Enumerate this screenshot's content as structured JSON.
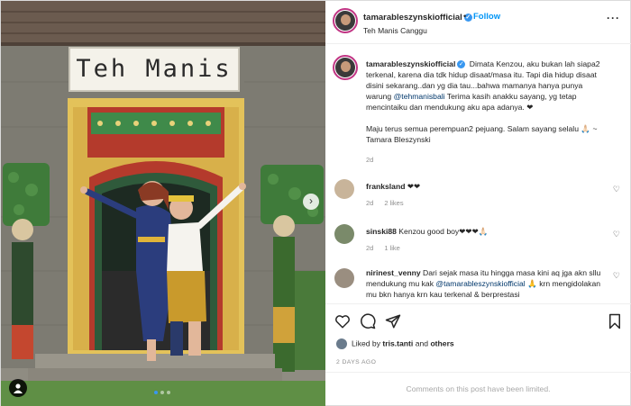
{
  "photo": {
    "sign_text": "Teh Manis",
    "next_icon": "chevron-right-icon",
    "user_tag_icon": "person-icon",
    "carousel": {
      "count": 3,
      "active": 1
    }
  },
  "post": {
    "username": "tamarableszynskiofficial",
    "verified_icon": "verified-badge-icon",
    "bullet": "•",
    "follow_label": "Follow",
    "location": "Teh Manis Canggu",
    "more_icon": "more-icon"
  },
  "caption": {
    "username": "tamarableszynskiofficial",
    "text_1": " Dimata Kenzou, aku bukan lah siapa2 terkenal, karena dia tdk hidup disaat/masa itu. Tapi dia hidup disaat disini sekarang..dan yg dia tau...bahwa mamanya hanya punya warung ",
    "mention": "@tehmanisbali",
    "text_2": " Terima kasih anakku sayang, yg tetap mencintaiku dan mendukung aku apa adanya. ❤",
    "text_3": "Maju terus semua perempuan2 pejuang. Salam sayang selalu 🙏🏻 ~ Tamara Bleszynski",
    "time": "2d"
  },
  "comments": [
    {
      "username": "franksland",
      "text": " ❤❤",
      "time": "2d",
      "likes": "2 likes"
    },
    {
      "username": "sinski88",
      "text": " Kenzou good boy❤❤❤🙏🏻",
      "time": "2d",
      "likes": "1 like"
    },
    {
      "username": "nirinest_venny",
      "text": " Dari sejak masa itu hingga masa kini aq jga akn sllu mendukung mu kak ",
      "mention": "@tamarableszynskiofficial",
      "text_2": " 🙏 krn mengidolakan mu bkn hanya krn kau terkenal & berprestasi"
    }
  ],
  "actions": {
    "like_icon": "heart-icon",
    "comment_icon": "comment-icon",
    "share_icon": "share-icon",
    "save_icon": "bookmark-icon"
  },
  "likes": {
    "prefix": "Liked by ",
    "user": "tris.tanti",
    "middle": " and ",
    "others": "others"
  },
  "timestamp": "2 DAYS AGO",
  "comments_limited": "Comments on this post have been limited."
}
